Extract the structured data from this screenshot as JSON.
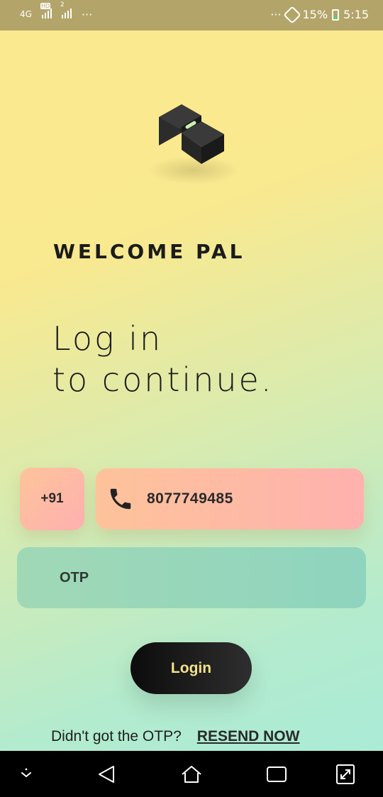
{
  "status_bar": {
    "network_type": "4G",
    "volte_badge": "HD",
    "sim2_label": "2",
    "overflow_left": "···",
    "overflow_right": "···",
    "battery": "15%",
    "time": "5:15"
  },
  "welcome": "WELCOME PAL",
  "headline": {
    "line1": "Log in",
    "line2": "to continue."
  },
  "phone": {
    "country_code": "+91",
    "number": "8077749485"
  },
  "otp": {
    "placeholder": "OTP",
    "value": ""
  },
  "login_label": "Login",
  "resend": {
    "prompt": "Didn't got the OTP?",
    "link": "RESEND NOW"
  },
  "icons": {
    "phone": "phone-icon",
    "logo": "app-logo",
    "nav_down": "chevron-down-icon",
    "nav_back": "back-icon",
    "nav_home": "home-icon",
    "nav_recents": "recents-icon",
    "nav_screenshot": "expand-icon"
  },
  "colors": {
    "status_bar": "#b3a56a",
    "login_text": "#f4e28a",
    "phone_field_start": "#fdc39a",
    "phone_field_end": "#ffb1ae",
    "otp_field": "#9ad6ba"
  }
}
